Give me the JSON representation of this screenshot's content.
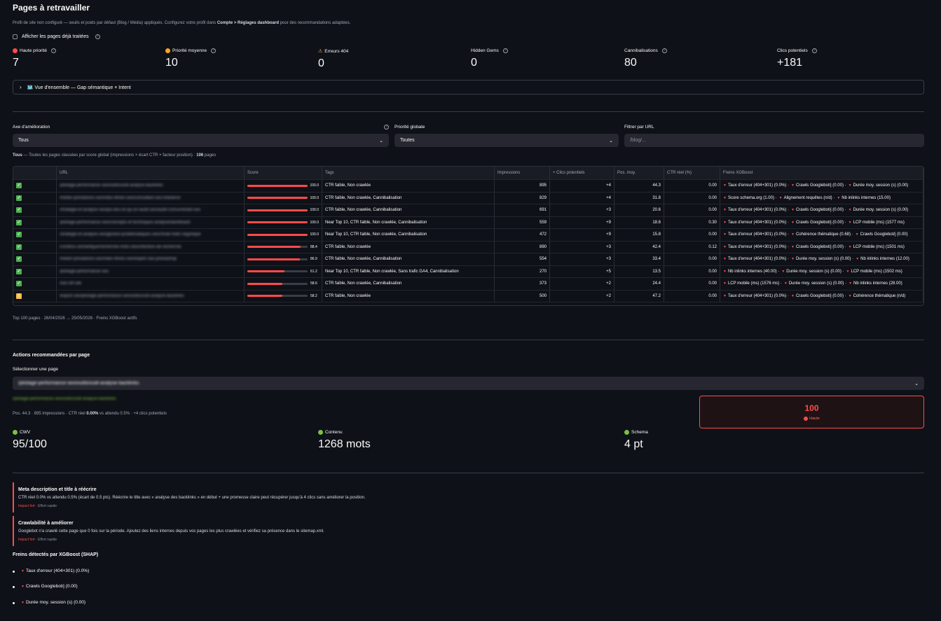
{
  "page": {
    "title": "Pages à retravailler",
    "subtitle_pre": "Profil de site non configuré — seuils et poids par défaut (Blog / Média) appliqués. Configurez votre profil dans ",
    "subtitle_bold": "Compte > Réglages dashboard",
    "subtitle_post": " pour des recommandations adaptées.",
    "show_processed_label": "Afficher les pages déjà traitées"
  },
  "metrics": [
    {
      "label": "Haute priorité",
      "value": "7",
      "dot": "#ff4b4b"
    },
    {
      "label": "Priorité moyenne",
      "value": "10",
      "dot": "#ffa421"
    },
    {
      "label": "Erreurs 404",
      "value": "0",
      "icon": "warning-icon"
    },
    {
      "label": "Hidden Gems",
      "value": "0"
    },
    {
      "label": "Cannibalisations",
      "value": "80"
    },
    {
      "label": "Clics potentiels",
      "value": "+181"
    }
  ],
  "expander": {
    "label": "🗺️ Vue d'ensemble — Gap sémantique × Intent"
  },
  "filters": {
    "axis_label": "Axe d'amélioration",
    "axis_value": "Tous",
    "priority_label": "Priorité globale",
    "priority_value": "Toutes",
    "url_label": "Filtrer par URL",
    "url_placeholder": "/blog/..."
  },
  "caption": {
    "bold1": "Tous",
    "text": " — Toutes les pages classées par score global (impressions × écart CTR × facteur position) · ",
    "bold2": "106",
    "end": " pages"
  },
  "table": {
    "headers": [
      "",
      "URL",
      "Score",
      "Tags",
      "Impressions",
      "+ Clics potentiels",
      "Pos. moy.",
      "CTR réel (%)",
      "Freins XGBoost"
    ],
    "rows": [
      {
        "status": "check",
        "url": "/pilotage-performance-seo/outils/outil-analyse-backlinks",
        "score": 100.0,
        "score_label": "100.0",
        "tags": "CTR faible, Non crawlée",
        "impr": "895",
        "clics": "+4",
        "pos": "44.3",
        "ctr": "0.00",
        "freins": [
          "Taux d'erreur (404+301) (0.0%) ·",
          "Crawls Googlebot/j (0.00) ·",
          "Durée moy. session (s) (0.00)"
        ]
      },
      {
        "status": "check",
        "url": "/metier-prestations-seo/rides-filmes-seo/consultant-seo-freelance",
        "score": 100.0,
        "score_label": "100.0",
        "tags": "CTR faible, Non crawlée, Cannibalisation",
        "impr": "829",
        "clics": "+4",
        "pos": "31.8",
        "ctr": "0.00",
        "freins": [
          "Score schema.org (1.00) ·",
          "Alignement requêtes (n/d) ·",
          "Nb inlinks internes (15.00)"
        ]
      },
      {
        "status": "check",
        "url": "/strategie-et-analyse-seo/pa-seo-ce-qu-un-audit-seo/audit-concurrentiel-seo",
        "score": 100.0,
        "score_label": "100.0",
        "tags": "CTR faible, Non crawlée, Cannibalisation",
        "impr": "691",
        "clics": "+3",
        "pos": "20.6",
        "ctr": "0.00",
        "freins": [
          "Taux d'erreur (404+301) (0.0%) ·",
          "Crawls Googlebot/j (0.00) ·",
          "Durée moy. session (s) (0.00)"
        ]
      },
      {
        "status": "check",
        "url": "/pilotage-performance-seo/concepts-et-techniques-analyse/dashboard",
        "score": 100.0,
        "score_label": "100.0",
        "tags": "Near Top 10, CTR faible, Non crawlée, Cannibalisation",
        "impr": "559",
        "clics": "+9",
        "pos": "18.6",
        "ctr": "0.30",
        "freins": [
          "Taux d'erreur (404+301) (0.0%) ·",
          "Crawls Googlebot/j (0.00) ·",
          "LCP mobile (ms) (1577 ms)"
        ]
      },
      {
        "status": "check",
        "url": "/strategie-et-analyse-seo/gestion-problematiques-seo/chute-trafic-organique",
        "score": 100.0,
        "score_label": "100.0",
        "tags": "Near Top 10, CTR faible, Non crawlée, Cannibalisation",
        "impr": "472",
        "clics": "+9",
        "pos": "15.8",
        "ctr": "0.00",
        "freins": [
          "Taux d'erreur (404+301) (0.0%) ·",
          "Cohérence thématique (0.68) ·",
          "Crawls Googlebot/j (0.00)"
        ]
      },
      {
        "status": "check",
        "url": "/contenu-semantique/recherche-mots-cles/intention-de-recherche",
        "score": 88.4,
        "score_label": "88.4",
        "tags": "CTR faible, Non crawlée",
        "impr": "890",
        "clics": "+3",
        "pos": "42.4",
        "ctr": "0.12",
        "freins": [
          "Taux d'erreur (404+301) (0.0%) ·",
          "Crawls Googlebot/j (0.00) ·",
          "LCP mobile (ms) (1501 ms)"
        ]
      },
      {
        "status": "check",
        "url": "/metier-prestations-seo/rides-filmes-seo/expert-seo-prestashop",
        "score": 86.9,
        "score_label": "86.9",
        "tags": "CTR faible, Non crawlée, Cannibalisation",
        "impr": "554",
        "clics": "+3",
        "pos": "33.4",
        "ctr": "0.00",
        "freins": [
          "Taux d'erreur (404+301) (0.0%) ·",
          "Durée moy. session (s) (0.00) ·",
          "Nb inlinks internes (12.00)"
        ]
      },
      {
        "status": "check",
        "url": "/pilotage-performance-seo",
        "score": 61.2,
        "score_label": "61.2",
        "tags": "Near Top 10, CTR faible, Non crawlée, Sans trafic GA4, Cannibalisation",
        "impr": "270",
        "clics": "+5",
        "pos": "13.5",
        "ctr": "0.00",
        "freins": [
          "Nb inlinks internes (40.00) ·",
          "Durée moy. session (s) (0.00) ·",
          "LCP mobile (ms) (1502 ms)"
        ]
      },
      {
        "status": "check",
        "url": "/seo-off-site",
        "score": 58.6,
        "score_label": "58.6",
        "tags": "CTR faible, Non crawlée, Cannibalisation",
        "impr": "373",
        "clics": "+2",
        "pos": "24.4",
        "ctr": "0.00",
        "freins": [
          "LCP mobile (ms) (1576 ms) ·",
          "Durée moy. session (s) (0.00) ·",
          "Nb inlinks internes (28.00)"
        ]
      },
      {
        "status": "warn",
        "url": "/export-seo/pilotage-performance-seo/outils/outil-analyse-backlinks",
        "score": 58.2,
        "score_label": "58.2",
        "tags": "CTR faible, Non crawlée",
        "impr": "500",
        "clics": "+2",
        "pos": "47.2",
        "ctr": "0.00",
        "freins": [
          "Taux d'erreur (404+301) (0.0%) ·",
          "Crawls Googlebot/j (0.00) ·",
          "Cohérence thématique (n/d)"
        ]
      }
    ]
  },
  "table_caption": "Top 100 pages · 26/04/2026 → 25/05/2026 · Freins XGBoost actifs",
  "actions": {
    "title": "Actions recommandées par page",
    "select_label": "Sélectionner une page",
    "select_value": "/pilotage-performance-seo/outils/outil-analyse-backlinks",
    "link": "/pilotage-performance-seo/outils/outil-analyse-backlinks",
    "stats_pre": "Pos. 44.3 · 895 impressions · CTR réel ",
    "stats_bold": "0.00%",
    "stats_post": " vs attendu 0.5% · +4 clics potentiels",
    "score": "100",
    "score_tag": "Haute"
  },
  "kpis": [
    {
      "label": "CWV",
      "value": "95/100"
    },
    {
      "label": "Contenu",
      "value": "1268 mots"
    },
    {
      "label": "Schema",
      "value": "4 pt"
    }
  ],
  "recommendations": [
    {
      "title": "Meta description et title à réécrire",
      "desc": "CTR réel 0.0% vs attendu 0.5% (écart de 0.5 pts). Réécrire le title avec « analyse des backlinks » en début + une promesse claire peut récupérer jusqu'à 4 clics sans améliorer la position.",
      "impact": "Impact fort",
      "effort": " · Effort rapide"
    },
    {
      "title": "Crawlabilité à améliorer",
      "desc": "Googlebot n'a crawlé cette page que 0 fois sur la période. Ajoutez des liens internes depuis vos pages les plus crawlées et vérifiez sa présence dans le sitemap.xml.",
      "impact": "Impact fort",
      "effort": " · Effort rapide"
    }
  ],
  "shap": {
    "title": "Freins détectés par XGBoost (SHAP)",
    "items": [
      "Taux d'erreur (404+301) (0.0%)",
      "Crawls Googlebot/j (0.00)",
      "Durée moy. session (s) (0.00)"
    ]
  },
  "colors": {
    "accent": "#ff4b4b",
    "success": "#7bc143",
    "warning": "#ffbd45",
    "bg": "#0e1117"
  }
}
